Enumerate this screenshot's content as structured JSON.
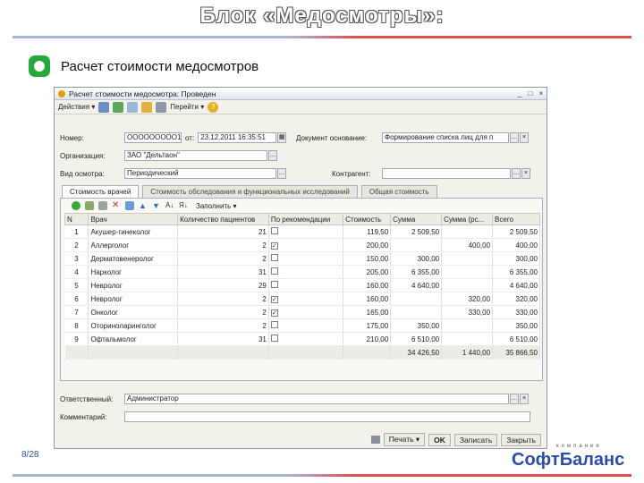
{
  "slide": {
    "title": "Блок «Медосмотры»:",
    "subtitle": "Расчет стоимости медосмотров",
    "page_number": "8/28",
    "logo_tagline": "компания",
    "logo_part1": "Софт",
    "logo_part2": "Баланс",
    "colors": {
      "bullet": "#26a83a",
      "logo_blue": "#2b4fa8",
      "logo_red": "#d03030"
    }
  },
  "window": {
    "title": "Расчет стоимости медосмотра: Проведен",
    "btn_minimize": "_",
    "btn_maximize": "□",
    "btn_close": "×",
    "toolbar": {
      "actions": "Действия ▾",
      "goto": "Перейти ▾",
      "help": "?"
    },
    "form": {
      "number_label": "Номер:",
      "number_value": "ООООООООО1",
      "from_label": "от:",
      "date_value": "23.12.2011 16:35:51",
      "basis_label": "Документ основание:",
      "basis_value": "Формирование списка лиц для п",
      "org_label": "Организация:",
      "org_value": "ЗАО \"Дельтаон\"",
      "exam_type_label": "Вид осмотра:",
      "exam_type_value": "Периодический",
      "contractor_label": "Контрагент:",
      "contractor_value": ""
    },
    "tabs": [
      "Стоимость врачей",
      "Стоимость обследования и функциональных исследований",
      "Общая стоимость"
    ],
    "panel_toolbar": {
      "fill": "Заполнить ▾"
    },
    "table": {
      "headers": [
        "N",
        "Врач",
        "Количество пациентов",
        "По рекомендации",
        "Стоимость",
        "Сумма",
        "Сумма (рс...",
        "Всего"
      ],
      "rows": [
        {
          "n": "1",
          "doctor": "Акушер-гинеколог",
          "patients": "21",
          "rec": false,
          "cost": "119,50",
          "sum": "2 509,50",
          "sum_rec": "",
          "total": "2 509,50"
        },
        {
          "n": "2",
          "doctor": "Аллерголог",
          "patients": "2",
          "rec": true,
          "cost": "200,00",
          "sum": "",
          "sum_rec": "400,00",
          "total": "400,00"
        },
        {
          "n": "3",
          "doctor": "Дерматовенеролог",
          "patients": "2",
          "rec": false,
          "cost": "150,00",
          "sum": "300,00",
          "sum_rec": "",
          "total": "300,00"
        },
        {
          "n": "4",
          "doctor": "Нарколог",
          "patients": "31",
          "rec": false,
          "cost": "205,00",
          "sum": "6 355,00",
          "sum_rec": "",
          "total": "6 355,00"
        },
        {
          "n": "5",
          "doctor": "Невролог",
          "patients": "29",
          "rec": false,
          "cost": "160,00",
          "sum": "4 640,00",
          "sum_rec": "",
          "total": "4 640,00"
        },
        {
          "n": "6",
          "doctor": "Невролог",
          "patients": "2",
          "rec": true,
          "cost": "160,00",
          "sum": "",
          "sum_rec": "320,00",
          "total": "320,00"
        },
        {
          "n": "7",
          "doctor": "Онколог",
          "patients": "2",
          "rec": true,
          "cost": "165,00",
          "sum": "",
          "sum_rec": "330,00",
          "total": "330,00"
        },
        {
          "n": "8",
          "doctor": "Оториноларинголог",
          "patients": "2",
          "rec": false,
          "cost": "175,00",
          "sum": "350,00",
          "sum_rec": "",
          "total": "350,00"
        },
        {
          "n": "9",
          "doctor": "Офтальмолог",
          "patients": "31",
          "rec": false,
          "cost": "210,00",
          "sum": "6 510,00",
          "sum_rec": "",
          "total": "6 510,00"
        }
      ],
      "totals": {
        "sum": "34 426,50",
        "sum_rec": "1 440,00",
        "total": "35 866,50"
      }
    },
    "responsible_label": "Ответственный:",
    "responsible_value": "Администратор",
    "comment_label": "Комментарий:",
    "comment_value": "",
    "bottom_buttons": {
      "print": "Печать ▾",
      "ok": "OK",
      "save": "Записать",
      "close": "Закрыть"
    }
  }
}
